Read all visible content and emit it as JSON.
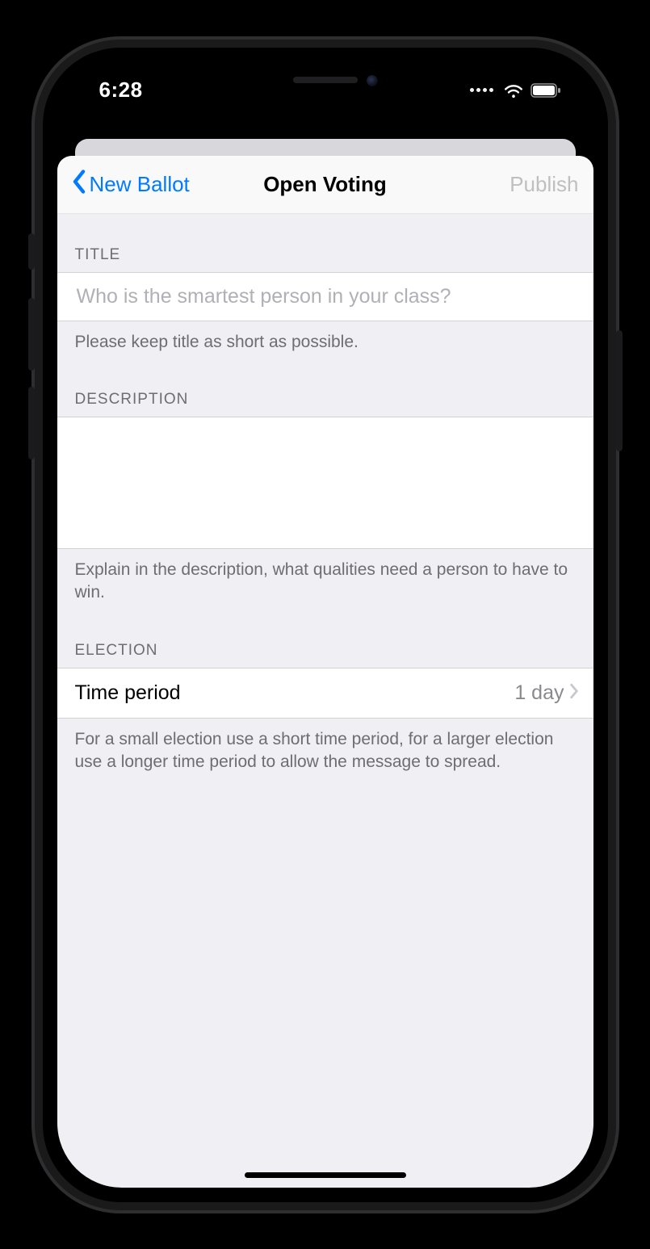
{
  "status": {
    "time": "6:28"
  },
  "nav": {
    "back_label": "New Ballot",
    "title": "Open Voting",
    "publish_label": "Publish"
  },
  "sections": {
    "title": {
      "header": "TITLE",
      "placeholder": "Who is the smartest person in your class?",
      "value": "",
      "footer": "Please keep title as short as possible."
    },
    "description": {
      "header": "DESCRIPTION",
      "value": "",
      "footer": "Explain in the description, what qualities need a person to have to win."
    },
    "election": {
      "header": "ELECTION",
      "row_label": "Time period",
      "row_value": "1 day",
      "footer": "For a small election use a short time period, for a larger election use a longer time period to allow the message to spread."
    }
  }
}
